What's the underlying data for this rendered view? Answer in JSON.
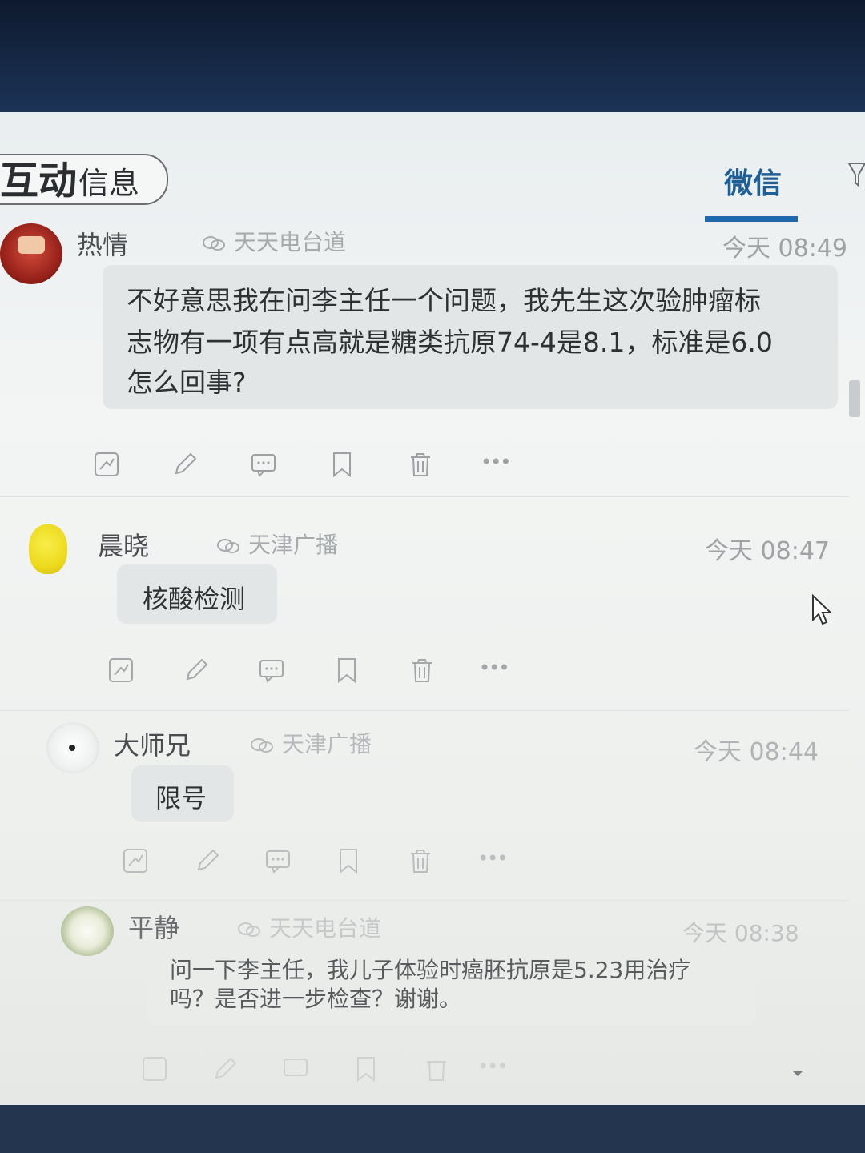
{
  "header": {
    "title_main": "互动",
    "title_sub": "信息",
    "tab_active": "微信"
  },
  "messages": [
    {
      "username": "热情",
      "source": "天天电台道",
      "time": "今天 08:49",
      "lines": [
        "不好意思我在问李主任一个问题，我先生这次验肿瘤标",
        "志物有一项有点高就是糖类抗原74-4是8.1，标准是6.0",
        "怎么回事?"
      ]
    },
    {
      "username": "晨晓",
      "source": "天津广播",
      "time": "今天 08:47",
      "lines": [
        "核酸检测"
      ]
    },
    {
      "username": "大师兄",
      "source": "天津广播",
      "time": "今天 08:44",
      "lines": [
        "限号"
      ]
    },
    {
      "username": "平静",
      "source": "天天电台道",
      "time": "今天 08:38",
      "lines": [
        "问一下李主任，我儿子体验时癌胚抗原是5.23用治疗",
        "吗？是否进一步检查？谢谢。"
      ]
    }
  ],
  "actions": {
    "more_label": "•••"
  },
  "colors": {
    "accent": "#2168a8",
    "bubble": "#e3e6e6"
  }
}
